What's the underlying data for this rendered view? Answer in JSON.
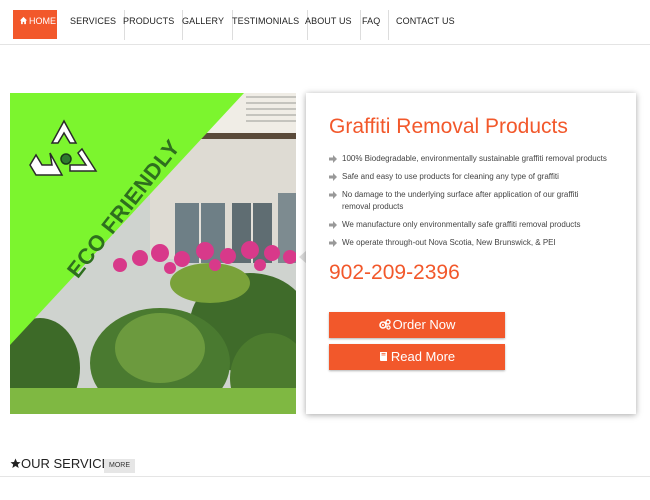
{
  "nav": {
    "home": "HOME",
    "items": [
      "SERVICES",
      "PRODUCTS",
      "GALLERY",
      "TESTIMONIALS",
      "ABOUT US",
      "FAQ",
      "CONTACT US"
    ]
  },
  "hero": {
    "badge_text": "ECO FRIENDLY",
    "title": "Graffiti Removal Products",
    "features": [
      "100% Biodegradable, environmentally sustainable graffiti removal products",
      "Safe and easy to use products for cleaning any type of graffiti",
      "No damage to the underlying surface after application of our graffiti removal products",
      "We manufacture only environmentally safe graffiti removal products",
      "We operate through-out Nova Scotia, New Brunswick, & PEI"
    ],
    "phone": "902-209-2396",
    "order_label": "Order Now",
    "read_label": "Read More"
  },
  "services": {
    "title": "OUR SERVICES",
    "more": "MORE"
  },
  "colors": {
    "accent": "#f2582b",
    "eco_green": "#7cf52e"
  },
  "icons": [
    "home-icon",
    "recycle-icon",
    "arrow-bullet-icon",
    "gears-icon",
    "book-icon",
    "star-icon"
  ]
}
